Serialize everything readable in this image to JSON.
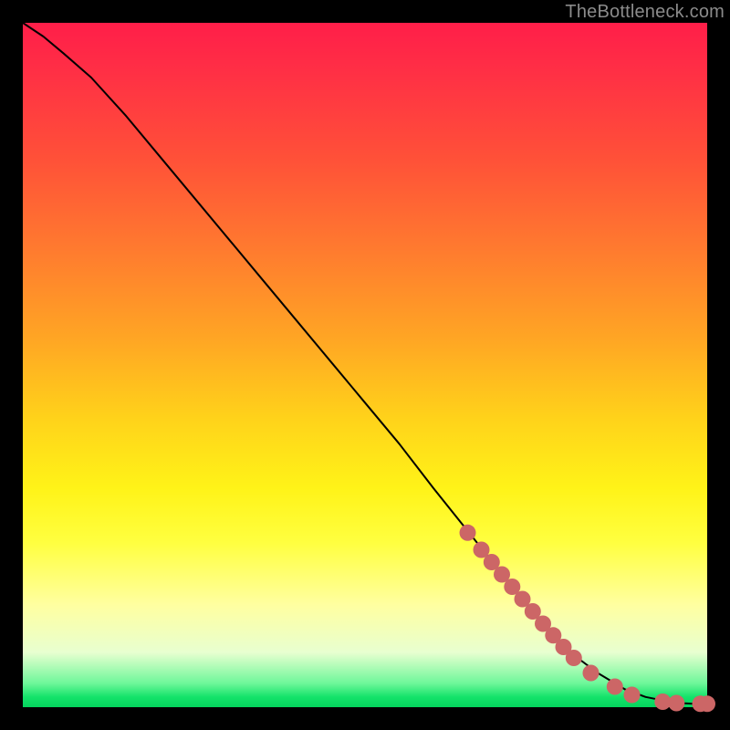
{
  "watermark": "TheBottleneck.com",
  "chart_data": {
    "type": "line",
    "title": "",
    "xlabel": "",
    "ylabel": "",
    "xlim": [
      0,
      100
    ],
    "ylim": [
      0,
      100
    ],
    "curve": {
      "x": [
        0,
        3,
        6,
        10,
        15,
        20,
        25,
        30,
        35,
        40,
        45,
        50,
        55,
        60,
        64,
        68,
        72,
        76,
        80,
        84,
        88,
        91,
        94,
        96,
        98,
        100
      ],
      "y": [
        100,
        98,
        95.5,
        92,
        86.5,
        80.5,
        74.5,
        68.5,
        62.5,
        56.5,
        50.5,
        44.5,
        38.5,
        32,
        27,
        22,
        17,
        12,
        8,
        5,
        2.6,
        1.5,
        0.9,
        0.6,
        0.5,
        0.5
      ]
    },
    "series": [
      {
        "name": "points",
        "x": [
          65,
          67,
          68.5,
          70,
          71.5,
          73,
          74.5,
          76,
          77.5,
          79,
          80.5,
          83,
          86.5,
          89,
          93.5,
          95.5,
          99,
          100
        ],
        "y": [
          25.5,
          23,
          21.2,
          19.4,
          17.6,
          15.8,
          14,
          12.2,
          10.5,
          8.8,
          7.2,
          5.0,
          3.0,
          1.8,
          0.8,
          0.6,
          0.5,
          0.5
        ]
      }
    ]
  },
  "colors": {
    "dot": "#cc6666",
    "curve": "#000000"
  }
}
